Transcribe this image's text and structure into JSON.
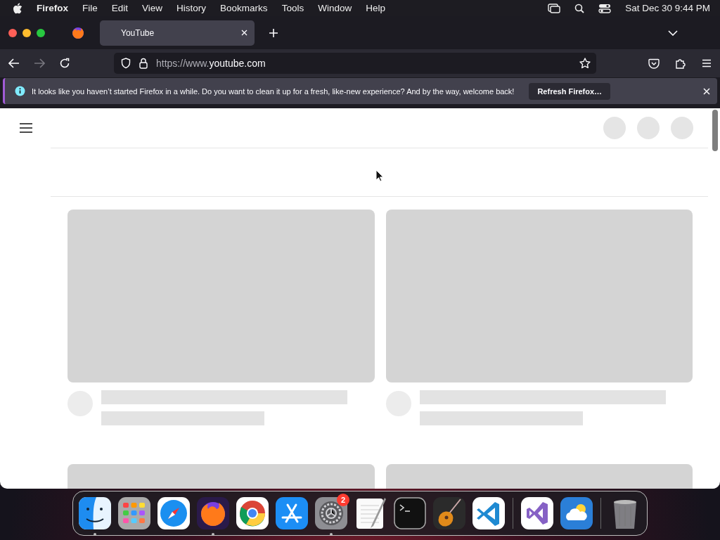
{
  "menu_bar": {
    "app": "Firefox",
    "items": [
      "File",
      "Edit",
      "View",
      "History",
      "Bookmarks",
      "Tools",
      "Window",
      "Help"
    ],
    "clock": "Sat Dec 30  9:44 PM"
  },
  "tabs": [
    {
      "title": "YouTube",
      "selected": true
    }
  ],
  "address_bar": {
    "scheme": "https://www.",
    "domain": "youtube.com"
  },
  "notification": {
    "message": "It looks like you haven’t started Firefox in a while. Do you want to clean it up for a fresh, like-new experience? And by the way, welcome back!",
    "button": "Refresh Firefox…"
  },
  "dock": [
    {
      "kind": "finder",
      "running": true
    },
    {
      "kind": "launchpad",
      "running": false
    },
    {
      "kind": "safari",
      "running": false
    },
    {
      "kind": "firefox",
      "running": true
    },
    {
      "kind": "chrome",
      "running": false
    },
    {
      "kind": "appstore",
      "running": false
    },
    {
      "kind": "settings",
      "running": true,
      "badge": "2"
    },
    {
      "kind": "textedit",
      "running": false
    },
    {
      "kind": "terminal",
      "running": false
    },
    {
      "kind": "garageband",
      "running": false
    },
    {
      "kind": "vscode",
      "running": false
    },
    {
      "kind": "separator"
    },
    {
      "kind": "visualstudio",
      "running": false
    },
    {
      "kind": "weather",
      "running": false
    },
    {
      "kind": "separator"
    },
    {
      "kind": "trash",
      "running": false
    }
  ]
}
